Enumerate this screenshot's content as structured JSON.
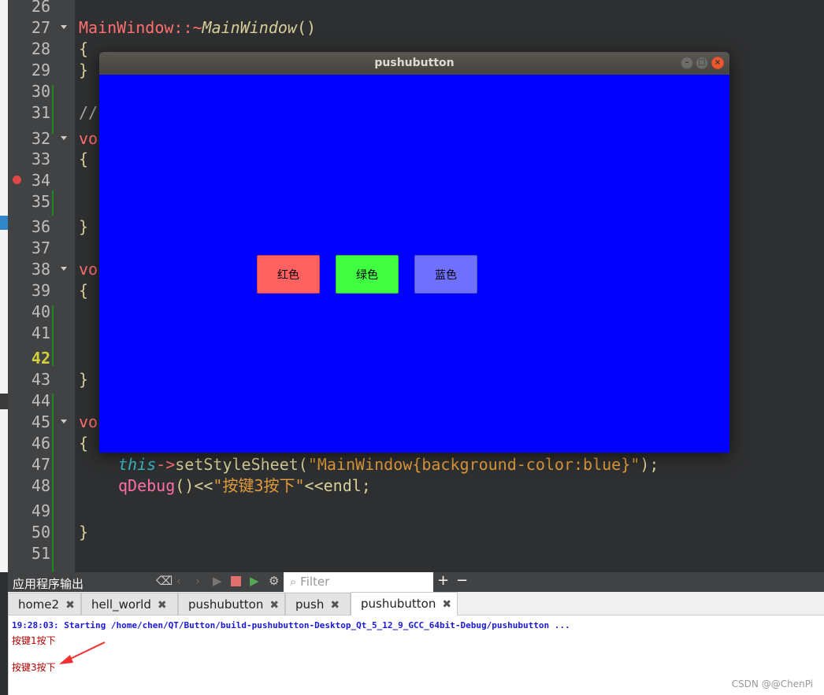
{
  "editor": {
    "line_numbers": [
      "26",
      "27",
      "28",
      "29",
      "30",
      "31",
      "32",
      "33",
      "34",
      "35",
      "36",
      "37",
      "38",
      "39",
      "40",
      "41",
      "42",
      "43",
      "44",
      "45",
      "46",
      "47",
      "48",
      "49",
      "50",
      "51"
    ],
    "current_line": "42",
    "lines": {
      "27": {
        "cls": "MainWindow",
        "sep": "::~",
        "fn": "MainWindow",
        "tail": "()"
      },
      "28": "{",
      "29": "}",
      "31": "//",
      "32": "vo",
      "33": "{",
      "36": "}",
      "38": "vo",
      "39": "{",
      "43": "}",
      "45": "vo",
      "46": "{",
      "50": "}",
      "47": {
        "kw": "this",
        "arrow": "->",
        "call": "setStyleSheet(",
        "str": "\"MainWindow{background-color:blue}\"",
        "end": ");"
      },
      "48": {
        "fn": "qDebug",
        "p": "()<<",
        "str": "\"按键3按下\"",
        "end": "<<endl;"
      }
    }
  },
  "app_window": {
    "title": "pushubutton",
    "background": "#0000ff",
    "buttons": [
      {
        "label": "红色",
        "color": "#ff6060"
      },
      {
        "label": "绿色",
        "color": "#40ff40"
      },
      {
        "label": "蓝色",
        "color": "#7070ff"
      }
    ]
  },
  "output_pane": {
    "title": "应用程序输出",
    "filter_placeholder": "Filter",
    "plus": "+",
    "minus": "−",
    "tabs": [
      {
        "label": "home2"
      },
      {
        "label": "hell_world"
      },
      {
        "label": "pushubutton"
      },
      {
        "label": "push"
      },
      {
        "label": "pushubutton",
        "active": true
      }
    ],
    "lines": [
      "19:28:03: Starting /home/chen/QT/Button/build-pushubutton-Desktop_Qt_5_12_9_GCC_64bit-Debug/pushubutton ...",
      "按键1按下",
      "按键3按下"
    ]
  },
  "watermark": "CSDN @@ChenPi"
}
